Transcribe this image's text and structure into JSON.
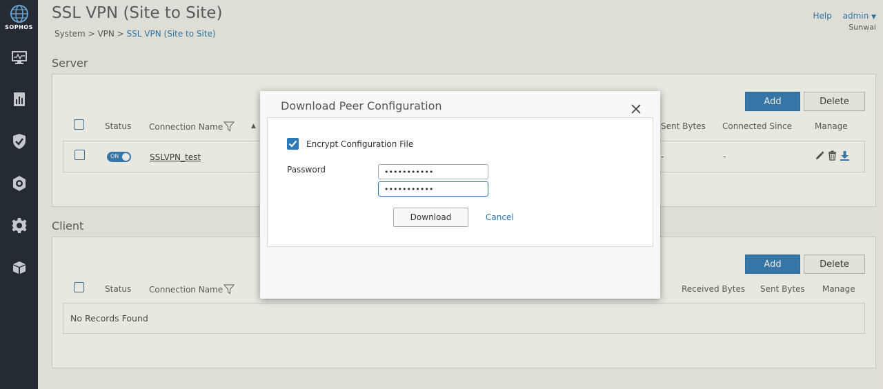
{
  "brand": {
    "logo_text": "SOPHOS"
  },
  "nav": {
    "icons": [
      "monitor-icon",
      "report-icon",
      "shield-icon",
      "protection-icon",
      "gear-icon",
      "cube-icon"
    ]
  },
  "header": {
    "title": "SSL VPN (Site to Site)",
    "breadcrumb": {
      "part1": "System",
      "sep": " > ",
      "part2": "VPN",
      "current": "SSL VPN (Site to Site)"
    },
    "help": "Help",
    "user": "admin",
    "user_sub": "Sunwai"
  },
  "server": {
    "title": "Server",
    "add_label": "Add",
    "delete_label": "Delete",
    "columns": {
      "status": "Status",
      "name": "Connection Name",
      "sent": "Sent Bytes",
      "since": "Connected Since",
      "manage": "Manage"
    },
    "row": {
      "toggle": "ON",
      "name": "SSLVPN_test",
      "sent": "-",
      "since": "-"
    }
  },
  "client": {
    "title": "Client",
    "add_label": "Add",
    "delete_label": "Delete",
    "columns": {
      "status": "Status",
      "name": "Connection Name",
      "received": "Received Bytes",
      "sent": "Sent Bytes",
      "manage": "Manage"
    },
    "empty": "No Records Found"
  },
  "modal": {
    "title": "Download Peer Configuration",
    "encrypt_label": "Encrypt Configuration File",
    "encrypt_checked": true,
    "password_label": "Password",
    "password_value": "•••••••••••",
    "confirm_value": "•••••••••••",
    "download_label": "Download",
    "cancel_label": "Cancel"
  },
  "colors": {
    "accent": "#2a78bc",
    "sidebar": "#252b33",
    "link": "#2676b8"
  }
}
